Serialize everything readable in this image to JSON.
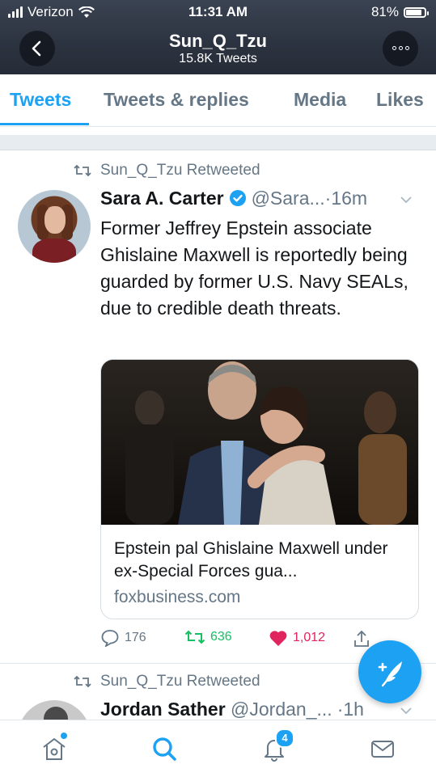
{
  "status_bar": {
    "carrier": "Verizon",
    "time": "11:31 AM",
    "battery": "81%"
  },
  "header": {
    "name": "Sun_Q_Tzu",
    "tweet_count": "15.8K Tweets"
  },
  "tabs": [
    {
      "label": "Tweets",
      "active": true
    },
    {
      "label": "Tweets & replies",
      "active": false
    },
    {
      "label": "Media",
      "active": false
    },
    {
      "label": "Likes",
      "active": false
    }
  ],
  "tweets": [
    {
      "retweeted_by": "Sun_Q_Tzu Retweeted",
      "author": "Sara A. Carter",
      "handle": "@Sara...",
      "separator": "·",
      "time": "16m",
      "text": "Former Jeffrey Epstein associate Ghislaine Maxwell is reportedly being guarded by former U.S. Navy SEALs, due to credible death threats.",
      "card": {
        "title": "Epstein pal Ghislaine Maxwell under ex-Special Forces gua...",
        "domain": "foxbusiness.com"
      },
      "actions": {
        "replies": "176",
        "retweets": "636",
        "likes": "1,012"
      }
    },
    {
      "retweeted_by": "Sun_Q_Tzu Retweeted",
      "author": "Jordan Sather",
      "handle": "@Jordan_...",
      "separator": "·",
      "time": "1h"
    }
  ],
  "bottom_nav": {
    "notifications_badge": "4"
  },
  "colors": {
    "accent": "#1da1f2",
    "retweet": "#17bf63",
    "like": "#e0245e",
    "header_bg": "#2c3340"
  },
  "icons": [
    "signal-icon",
    "wifi-icon",
    "battery-icon",
    "back-arrow-icon",
    "more-icon",
    "retweet-icon",
    "verified-icon",
    "chevron-down-icon",
    "reply-icon",
    "heart-icon",
    "share-icon",
    "compose-icon",
    "home-icon",
    "search-icon",
    "bell-icon",
    "mail-icon"
  ]
}
